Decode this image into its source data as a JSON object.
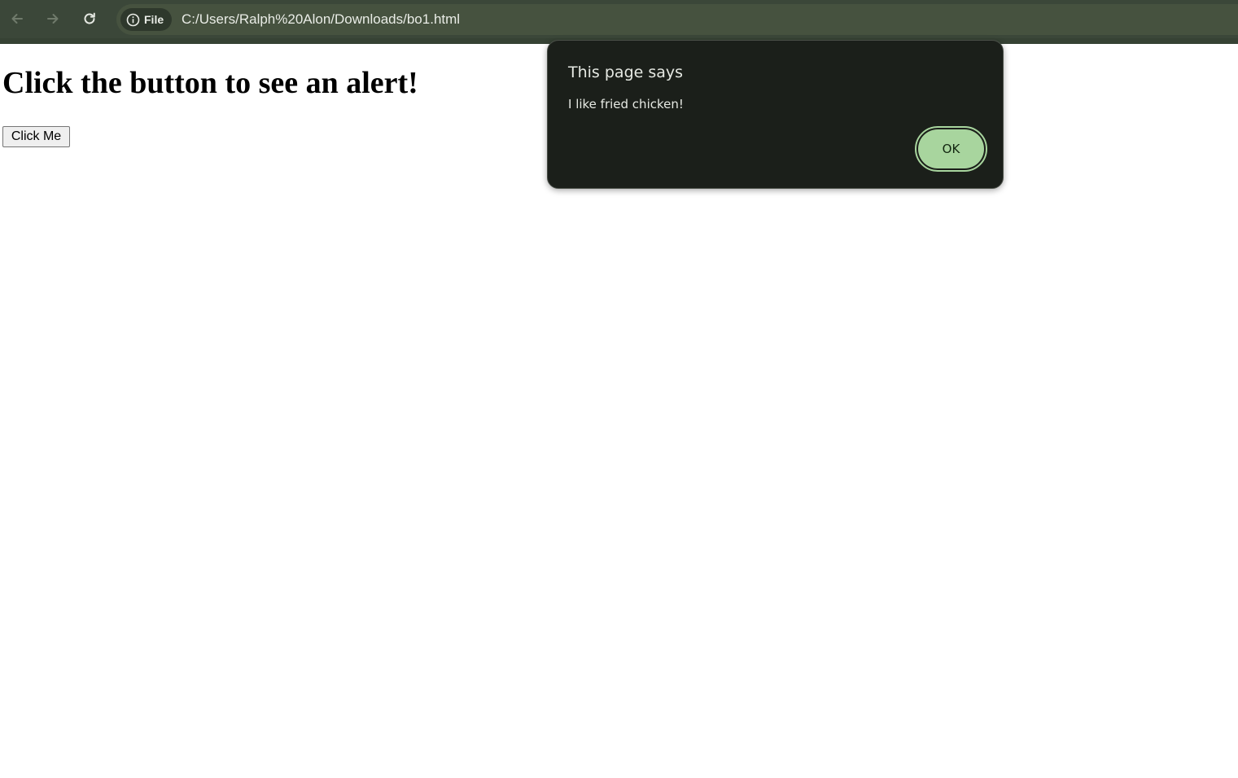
{
  "browser": {
    "back_icon": "arrow-left-icon",
    "forward_icon": "arrow-right-icon",
    "reload_icon": "reload-icon",
    "site_info_icon": "info-icon",
    "site_chip_label": "File",
    "url": "C:/Users/Ralph%20Alon/Downloads/bo1.html"
  },
  "page": {
    "heading": "Click the button to see an alert!",
    "button_label": "Click Me"
  },
  "dialog": {
    "title": "This page says",
    "message": "I like fried chicken!",
    "ok_label": "OK"
  },
  "colors": {
    "toolbar": "#3b4739",
    "dialog_background": "#1b1f1a",
    "ok_button": "#a8d59e"
  }
}
